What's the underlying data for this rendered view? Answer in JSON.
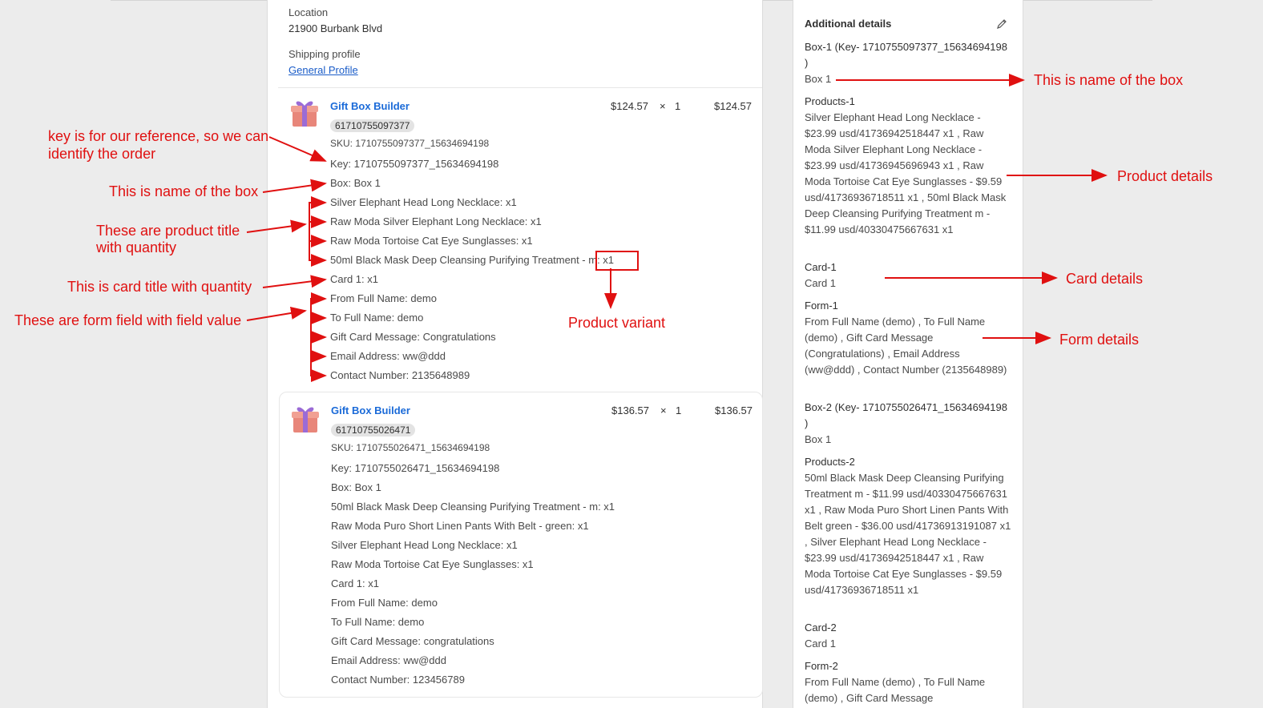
{
  "shipping": {
    "location_label": "Location",
    "location_value": "21900 Burbank Blvd",
    "profile_label": "Shipping profile",
    "profile_link": "General Profile"
  },
  "items": [
    {
      "title": "Gift Box Builder",
      "badge": "61710755097377",
      "sku": "SKU: 1710755097377_15634694198",
      "price": "$124.57",
      "times": "×",
      "qty": "1",
      "total": "$124.57",
      "lines": [
        "Key: 1710755097377_15634694198",
        "Box: Box 1",
        "Silver Elephant Head Long Necklace: x1",
        "Raw Moda Silver Elephant Long Necklace: x1",
        "Raw Moda Tortoise Cat Eye Sunglasses: x1",
        "50ml Black Mask Deep Cleansing Purifying Treatment - m: x1",
        "Card 1: x1",
        "From Full Name: demo",
        "To Full Name: demo",
        "Gift Card Message: Congratulations",
        "Email Address: ww@ddd",
        "Contact Number: 2135648989"
      ]
    },
    {
      "title": "Gift Box Builder",
      "badge": "61710755026471",
      "sku": "SKU: 1710755026471_15634694198",
      "price": "$136.57",
      "times": "×",
      "qty": "1",
      "total": "$136.57",
      "lines": [
        "Key: 1710755026471_15634694198",
        "Box: Box 1",
        "50ml Black Mask Deep Cleansing Purifying Treatment - m: x1",
        "Raw Moda Puro Short Linen Pants With Belt - green: x1",
        "Silver Elephant Head Long Necklace: x1",
        "Raw Moda Tortoise Cat Eye Sunglasses: x1",
        "Card 1: x1",
        "From Full Name: demo",
        "To Full Name: demo",
        "Gift Card Message: congratulations",
        "Email Address: ww@ddd",
        "Contact Number: 123456789"
      ]
    }
  ],
  "additional": {
    "title": "Additional details",
    "blocks": [
      {
        "label": "Box-1 (Key- 1710755097377_15634694198 )",
        "value": "Box 1"
      },
      {
        "label": "Products-1",
        "value": "Silver Elephant Head Long Necklace - $23.99 usd/41736942518447 x1 , Raw Moda Silver Elephant Long Necklace - $23.99 usd/41736945696943 x1 , Raw Moda Tortoise Cat Eye Sunglasses - $9.59 usd/41736936718511 x1 , 50ml Black Mask Deep Cleansing Purifying Treatment m - $11.99 usd/40330475667631 x1"
      },
      {
        "label": "Card-1",
        "value": "Card 1"
      },
      {
        "label": "Form-1",
        "value": "From Full Name (demo) , To Full Name (demo) , Gift Card Message (Congratulations) , Email Address (ww@ddd) , Contact Number (2135648989)"
      },
      {
        "label": "Box-2 (Key- 1710755026471_15634694198 )",
        "value": "Box 1"
      },
      {
        "label": "Products-2",
        "value": "50ml Black Mask Deep Cleansing Purifying Treatment m - $11.99 usd/40330475667631 x1 , Raw Moda Puro Short Linen Pants With Belt green - $36.00 usd/41736913191087 x1 , Silver Elephant Head Long Necklace - $23.99 usd/41736942518447 x1 , Raw Moda Tortoise Cat Eye Sunglasses - $9.59 usd/41736936718511 x1"
      },
      {
        "label": "Card-2",
        "value": "Card 1"
      },
      {
        "label": "Form-2",
        "value": "From Full Name (demo) , To Full Name (demo) , Gift Card Message"
      }
    ]
  },
  "annotations": {
    "key_note_1": "key is for our reference, so we can",
    "key_note_2": "identify the order",
    "box_name_left": "This is name of the box",
    "product_title_1": "These are product title",
    "product_title_2": "with quantity",
    "card_title": "This is card title  with quantity",
    "form_field": "These are form field with field value",
    "product_variant": "Product variant",
    "box_name_right": "This is name of the box",
    "product_details": "Product details",
    "card_details": "Card details",
    "form_details": "Form details"
  },
  "colors": {
    "annotation": "#e01010",
    "link": "#1a5cc8"
  }
}
